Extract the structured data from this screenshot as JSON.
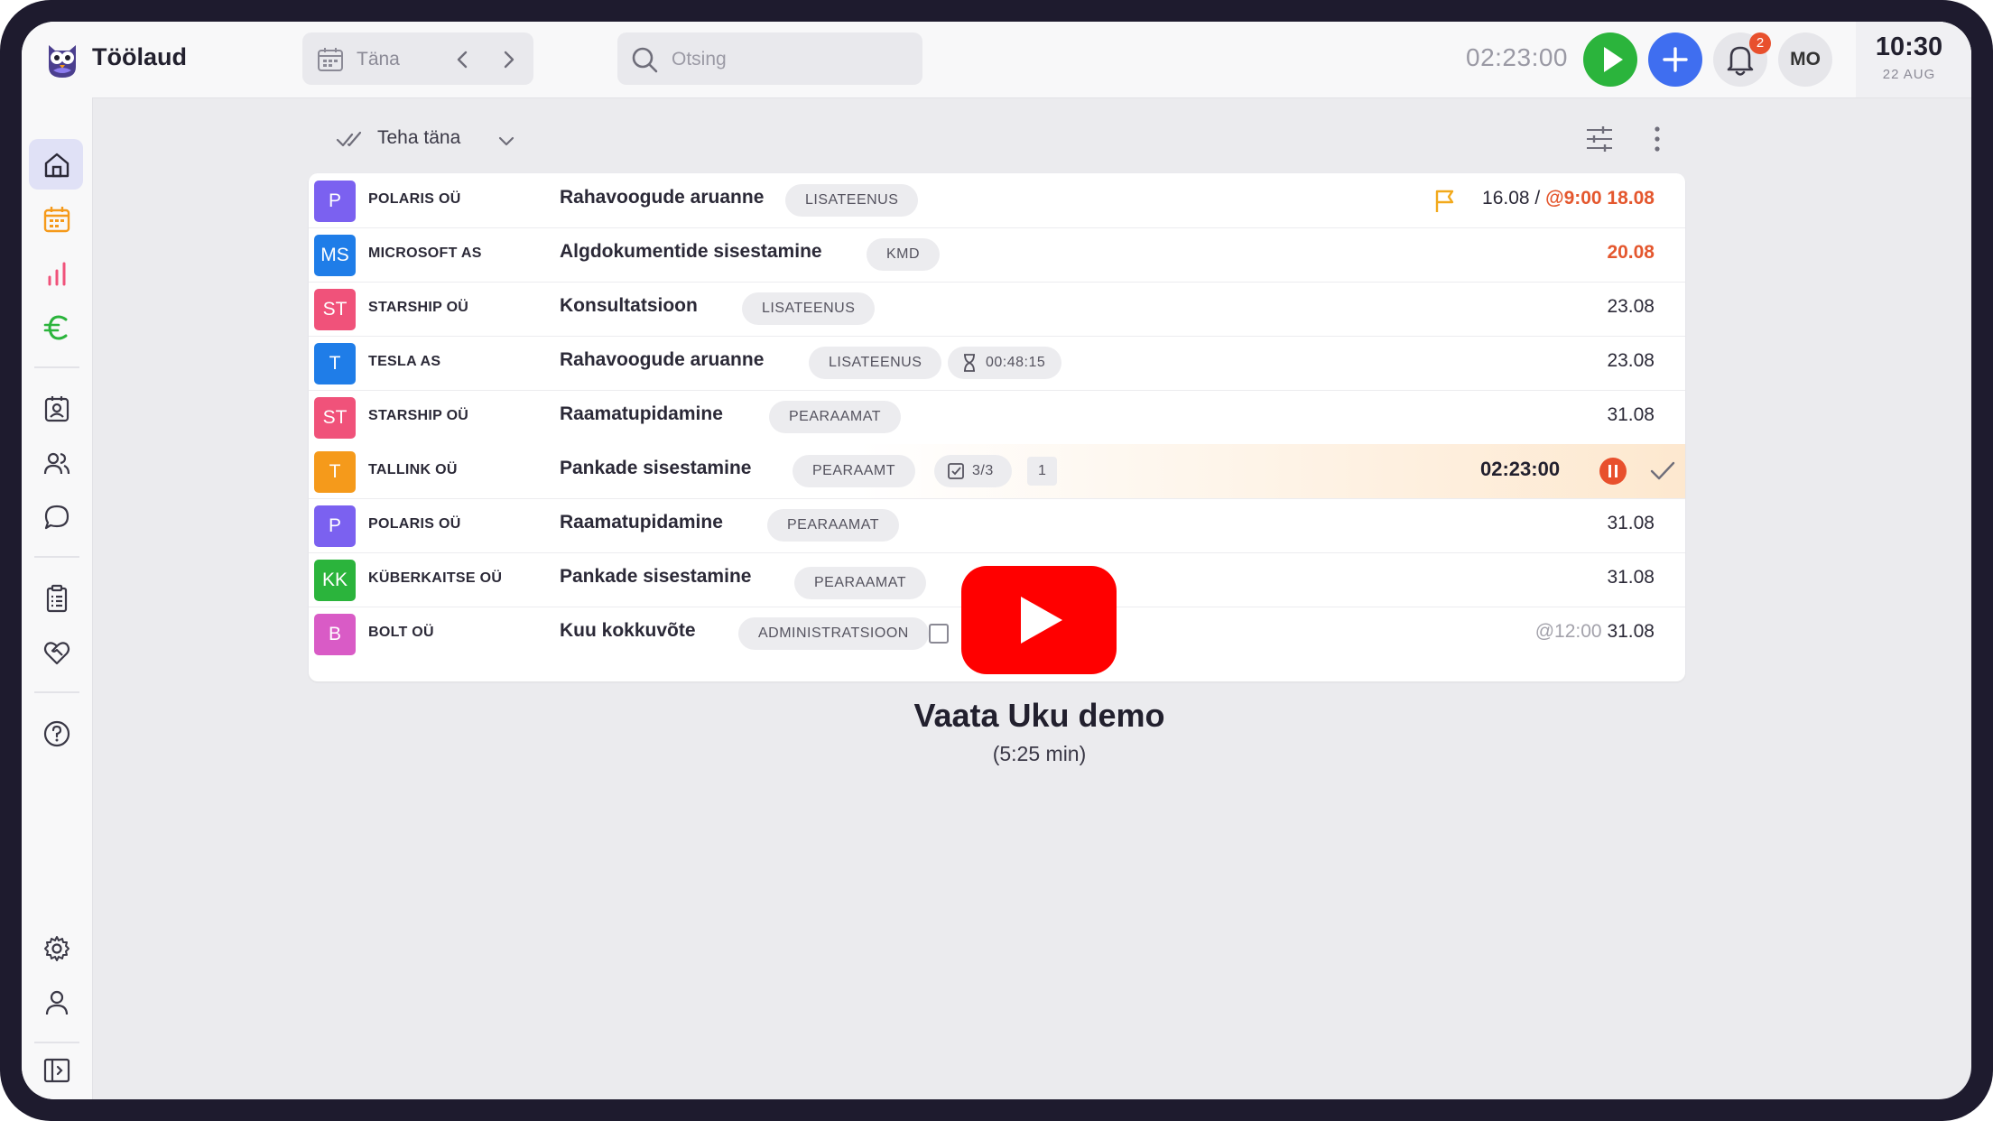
{
  "header": {
    "title": "Töölaud",
    "date_label": "Täna",
    "search_placeholder": "Otsing",
    "timer": "02:23:00",
    "notification_count": "2",
    "avatar_initials": "MO",
    "clock_time": "10:30",
    "clock_date": "22 AUG"
  },
  "toolbar": {
    "view_label": "Teha täna"
  },
  "tasks": [
    {
      "initials": "P",
      "color": "#7b61f0",
      "client": "POLARIS OÜ",
      "task": "Rahavoogude aruanne",
      "tag": "LISATEENUS",
      "flag": true,
      "due_prefix": "16.08 / ",
      "due_red": "@9:00 18.08"
    },
    {
      "initials": "MS",
      "color": "#1f7de8",
      "client": "MICROSOFT AS",
      "task": "Algdokumentide sisestamine",
      "tag": "KMD",
      "due_red": "20.08"
    },
    {
      "initials": "ST",
      "color": "#f0527a",
      "client": "STARSHIP OÜ",
      "task": "Konsultatsioon",
      "tag": "LISATEENUS",
      "due": "23.08"
    },
    {
      "initials": "T",
      "color": "#1f7de8",
      "client": "TESLA AS",
      "task": "Rahavoogude aruanne",
      "tag": "LISATEENUS",
      "timer_tag": "00:48:15",
      "due": "23.08"
    },
    {
      "initials": "ST",
      "color": "#f0527a",
      "client": "STARSHIP OÜ",
      "task": "Raamatupidamine",
      "tag": "PEARAAMAT",
      "due": "31.08"
    },
    {
      "initials": "T",
      "color": "#f59a1b",
      "client": "TALLINK OÜ",
      "task": "Pankade sisestamine",
      "tag": "PEARAAMT",
      "checklist": "3/3",
      "count": "1",
      "running_time": "02:23:00"
    },
    {
      "initials": "P",
      "color": "#7b61f0",
      "client": "POLARIS OÜ",
      "task": "Raamatupidamine",
      "tag": "PEARAAMAT",
      "due": "31.08"
    },
    {
      "initials": "KK",
      "color": "#2bb43c",
      "client": "KÜBERKAITSE OÜ",
      "task": "Pankade sisestamine",
      "tag": "PEARAAMAT",
      "due": "31.08"
    },
    {
      "initials": "B",
      "color": "#d95bc6",
      "client": "BOLT OÜ",
      "task": "Kuu kokkuvõte",
      "tag": "ADMINISTRATSIOON",
      "due_grey": "@12:00 ",
      "due": "31.08"
    }
  ],
  "video": {
    "title": "Vaata Uku demo",
    "duration": "(5:25 min)"
  },
  "icons": {
    "sidebar": [
      "home-icon",
      "calendar-icon",
      "chart-icon",
      "euro-icon",
      "contacts-icon",
      "users-icon",
      "chat-icon",
      "clipboard-icon",
      "heart-handshake-icon",
      "help-icon",
      "settings-icon",
      "profile-icon",
      "collapse-sidebar-icon"
    ]
  }
}
